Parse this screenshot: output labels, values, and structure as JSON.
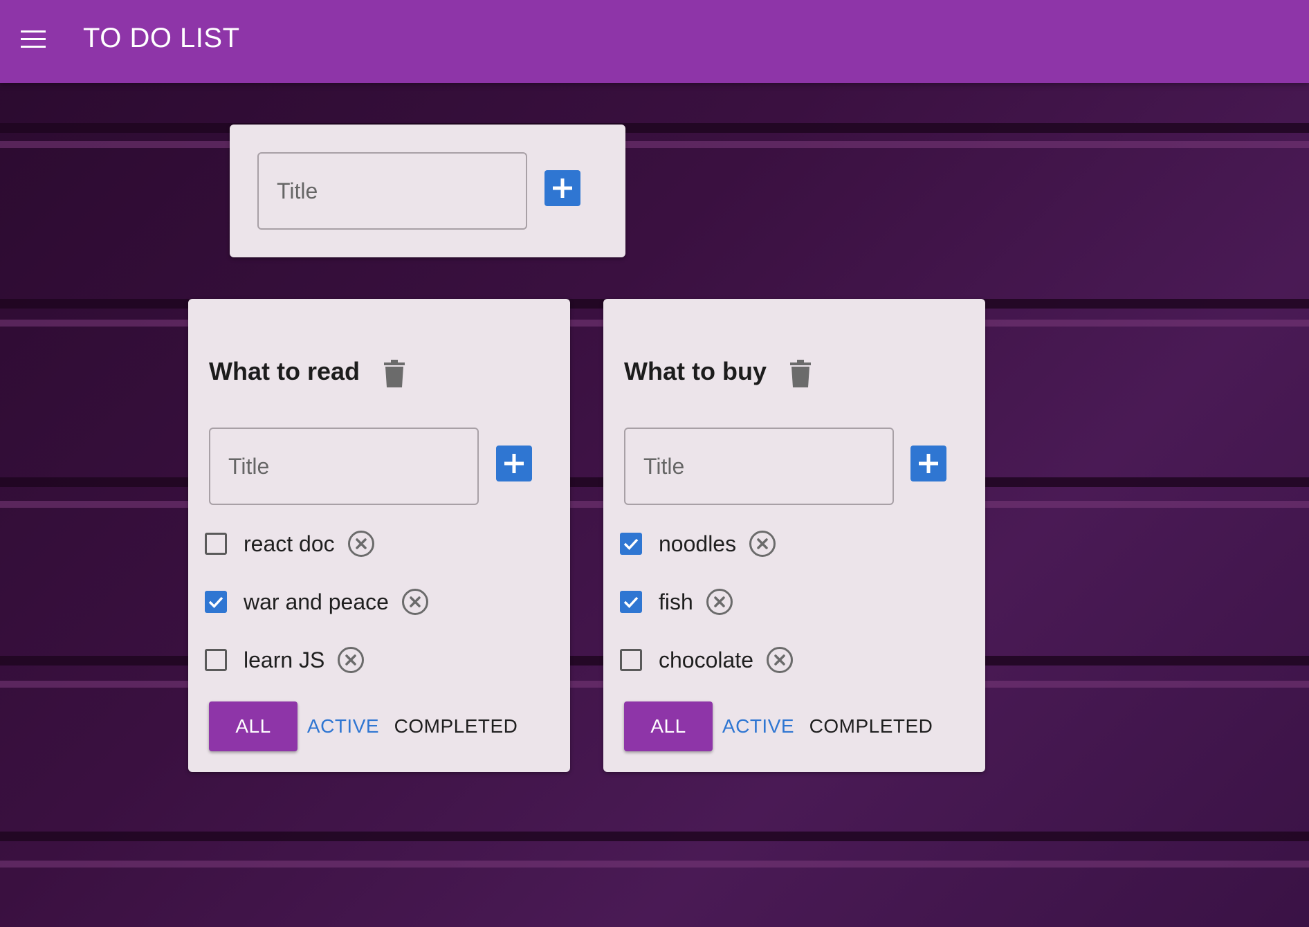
{
  "app": {
    "title": "TO DO LIST"
  },
  "new_list": {
    "placeholder": "Title"
  },
  "lists": [
    {
      "title": "What to read",
      "input_placeholder": "Title",
      "tasks": [
        {
          "label": "react doc",
          "done": false
        },
        {
          "label": "war and peace",
          "done": true
        },
        {
          "label": "learn JS",
          "done": false
        }
      ],
      "filters": {
        "all": "ALL",
        "active": "ACTIVE",
        "completed": "COMPLETED"
      },
      "selected_filter": "ALL"
    },
    {
      "title": "What to buy",
      "input_placeholder": "Title",
      "tasks": [
        {
          "label": "noodles",
          "done": true
        },
        {
          "label": "fish",
          "done": true
        },
        {
          "label": "chocolate",
          "done": false
        }
      ],
      "filters": {
        "all": "ALL",
        "active": "ACTIVE",
        "completed": "COMPLETED"
      },
      "selected_filter": "ALL"
    }
  ],
  "colors": {
    "appbar": "#8e35a8",
    "accent_blue": "#2f76d2",
    "card": "#ece4ea"
  },
  "icons": {
    "menu": "menu-icon",
    "add": "plus-icon",
    "delete_list": "trash-icon",
    "remove_task": "close-circle-icon",
    "checked": "checkmark-icon"
  }
}
